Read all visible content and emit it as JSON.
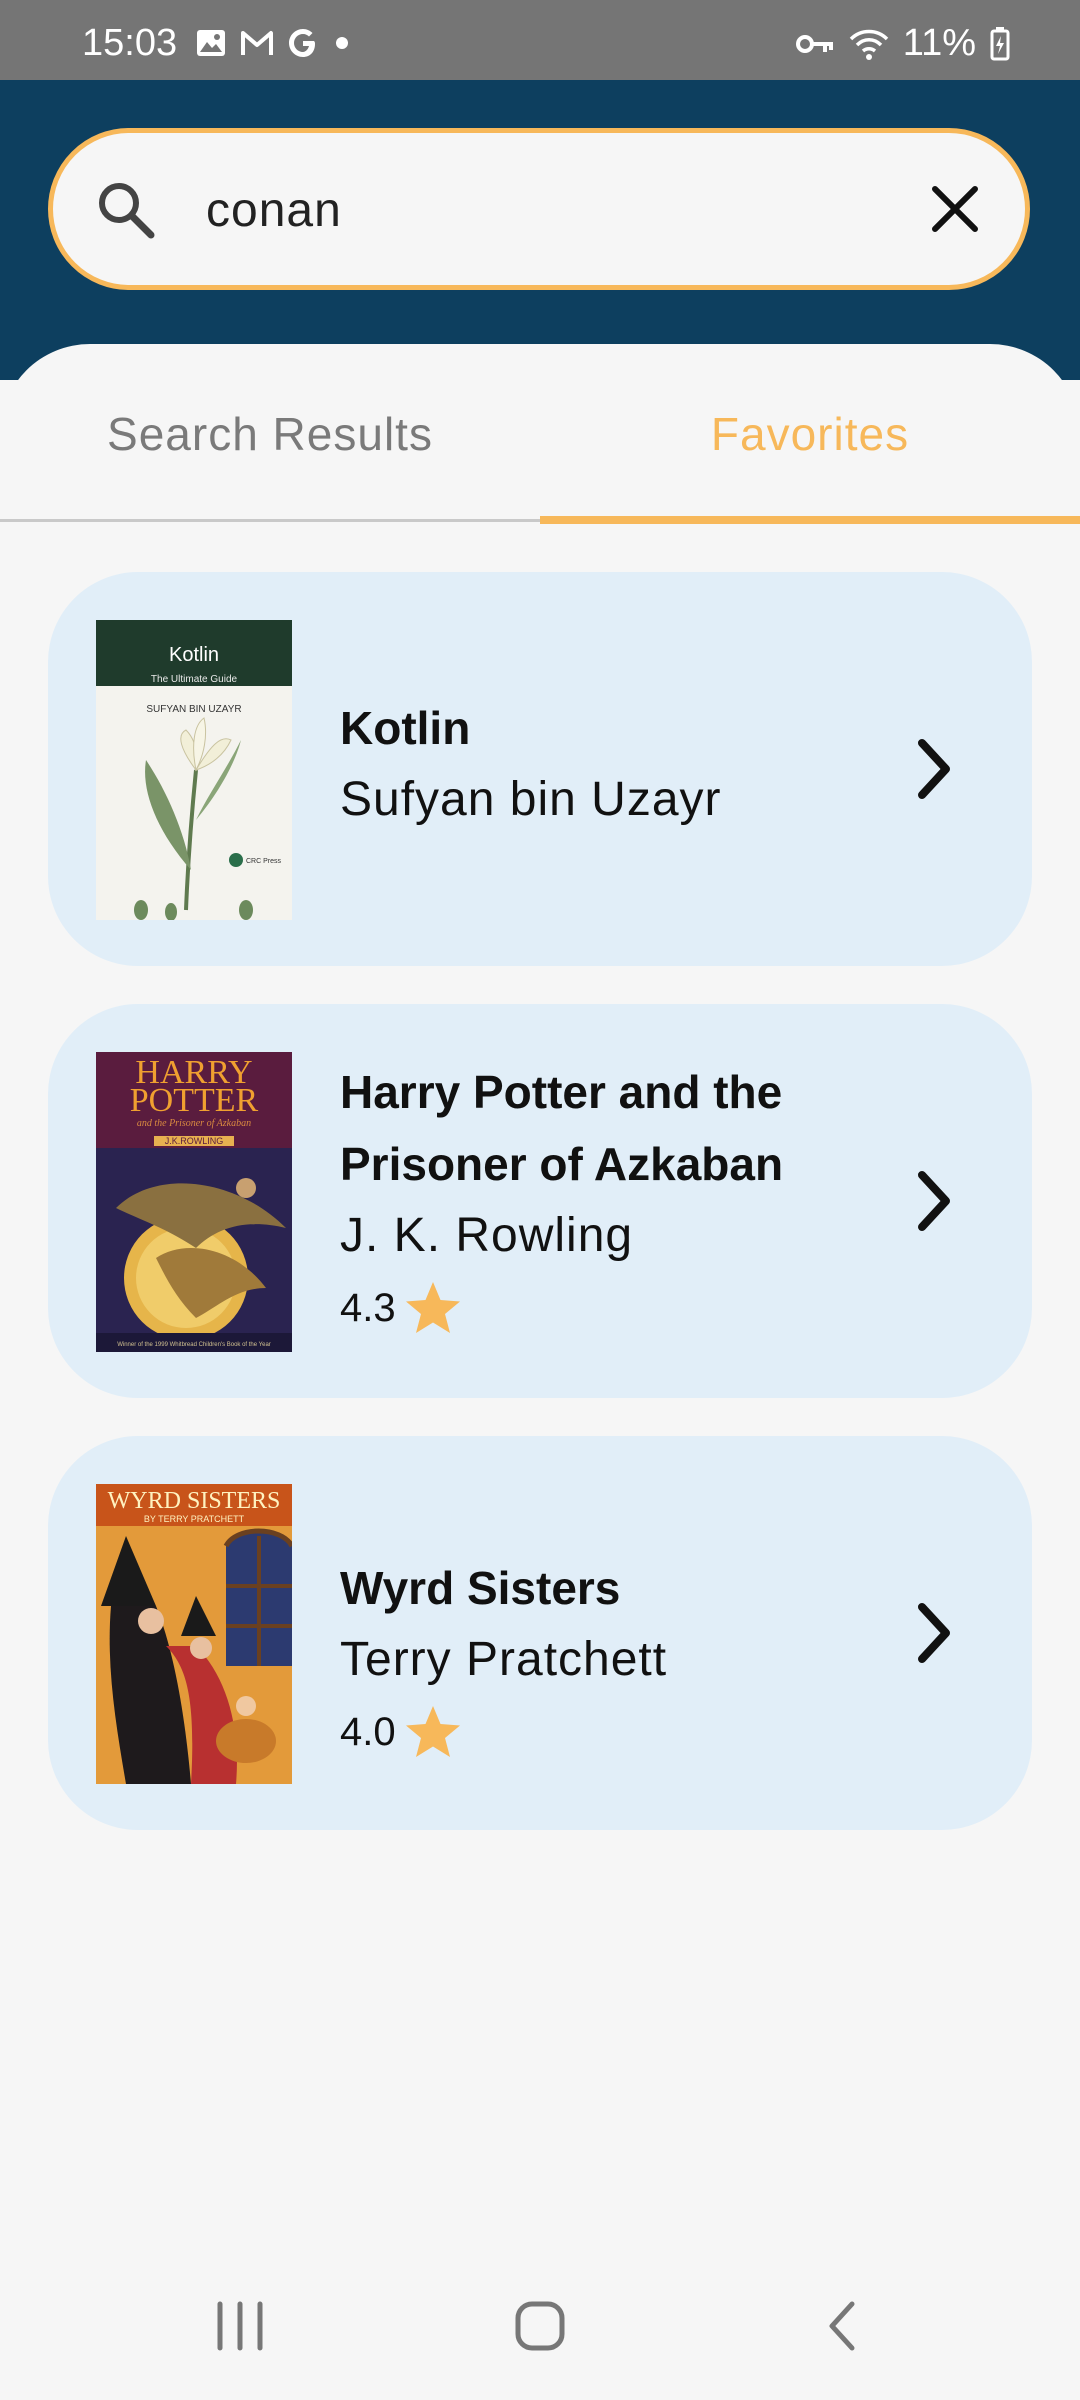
{
  "status": {
    "time": "15:03",
    "battery": "11%",
    "icons": [
      "image-icon",
      "gmail-icon",
      "google-icon",
      "dot-icon",
      "vpn-key-icon",
      "wifi-icon",
      "battery-icon"
    ]
  },
  "search": {
    "query": "conan",
    "icon": "search-icon",
    "clear_icon": "close-icon",
    "border_color": "#f7b85a"
  },
  "tabs": [
    {
      "label": "Search Results",
      "selected": false
    },
    {
      "label": "Favorites",
      "selected": true
    }
  ],
  "books": [
    {
      "title": "Kotlin",
      "author": "Sufyan bin Uzayr",
      "rating": null,
      "cover": {
        "title": "Kotlin",
        "subtitle": "The Ultimate Guide",
        "author": "SUFYAN BIN UZAYR",
        "publisher": "CRC Press"
      }
    },
    {
      "title": "Harry Potter and the Prisoner of Azkaban",
      "title_lines": [
        "Harry Potter and the",
        "Prisoner of Azkaban"
      ],
      "author": "J. K. Rowling",
      "rating": "4.3",
      "cover": {
        "title_line1": "HARRY",
        "title_line2": "POTTER",
        "subtitle": "and the Prisoner of Azkaban",
        "author": "J.K.ROWLING",
        "footer": "Winner of the 1999 Whitbread Children's Book of the Year"
      }
    },
    {
      "title": "Wyrd Sisters",
      "author": "Terry Pratchett",
      "rating": "4.0",
      "cover": {
        "title": "WYRD SISTERS",
        "author": "BY TERRY PRATCHETT"
      }
    }
  ],
  "colors": {
    "header": "#0d3f5f",
    "accent": "#f7b85a",
    "card": "#e1eef8",
    "background": "#f6f6f6",
    "status_bar": "#757575"
  },
  "nav": [
    "recent-apps-icon",
    "home-icon",
    "back-icon"
  ]
}
